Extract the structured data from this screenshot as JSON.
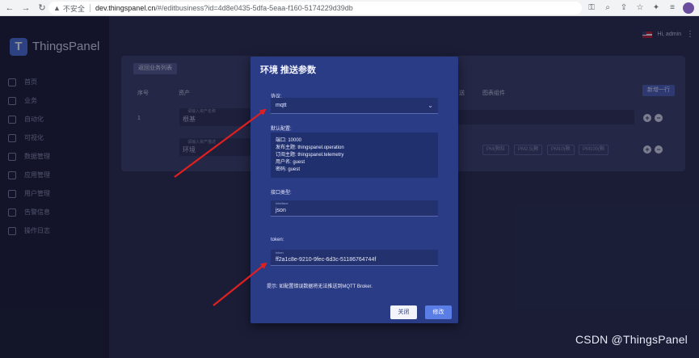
{
  "browser": {
    "insecure_label": "不安全",
    "url_host": "dev.thingspanel.cn",
    "url_path": "/#/editbusiness?id=4d8e0435-5dfa-5eaa-f160-5174229d39db",
    "nav": {
      "back": "←",
      "forward": "→",
      "reload": "↻",
      "warning": "▲"
    },
    "icons": {
      "key": "⚿",
      "zoom": "⌕",
      "share": "⇪",
      "star": "☆",
      "extensions": "✦",
      "reading": "≡"
    }
  },
  "app": {
    "logo_letter": "T",
    "name": "ThingsPanel",
    "collapse": "‹",
    "greeting": "Hi, admin",
    "more": "⋮"
  },
  "sidebar": {
    "items": [
      {
        "label": "首页",
        "icon": "home-icon"
      },
      {
        "label": "业务",
        "icon": "business-icon"
      },
      {
        "label": "自动化",
        "icon": "automation-icon"
      },
      {
        "label": "可视化",
        "icon": "visualization-icon"
      },
      {
        "label": "数据管理",
        "icon": "data-icon"
      },
      {
        "label": "应用管理",
        "icon": "apps-icon"
      },
      {
        "label": "用户管理",
        "icon": "users-icon"
      },
      {
        "label": "告警信息",
        "icon": "alarm-icon"
      },
      {
        "label": "操作日志",
        "icon": "log-icon"
      }
    ]
  },
  "background_card": {
    "back_button": "返回业务列表",
    "columns": {
      "no": "序号",
      "asset": "资产",
      "push": "送",
      "chart": "图表组件"
    },
    "add_row_button": "新增一行",
    "row1": {
      "no": "1",
      "field_label": "请输入资产名称",
      "field_value": "根基"
    },
    "row2": {
      "field_label": "请输入资产描述",
      "field_value": "环境"
    },
    "pm_tags": [
      "PM(颗粒",
      "PM2.5(颗",
      "PM10(颗",
      "PM100(颗"
    ],
    "plus": "+",
    "minus": "−"
  },
  "modal": {
    "title": "环境 推送参数",
    "protocol_label": "协议:",
    "protocol_value": "mqtt",
    "chevron": "⌄",
    "default_config_label": "默认配置:",
    "config_lines": [
      "端口: 10000",
      "发布主题: thingspanel.operation",
      "订阅主题: thingspanel.telemetry",
      "用户名: guest",
      "密码: guest"
    ],
    "interface_label": "接口类型:",
    "interface_float": "Interface",
    "interface_value": "json",
    "token_label": "token:",
    "token_float": "token",
    "token_value": "ff2a1c8e-9210-9fec-6d3c-51186764744f",
    "tip": "提示: 如配置错误数据将无法推送到MQTT Broker.",
    "close_button": "关闭",
    "save_button": "修改"
  },
  "watermark": "CSDN @ThingsPanel",
  "colors": {
    "arrow": "#e02020",
    "modal_bg": "#2b3c87",
    "primary": "#5a7de6"
  }
}
